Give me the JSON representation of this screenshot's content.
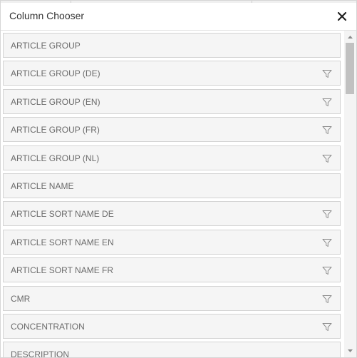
{
  "dialog": {
    "title": "Column Chooser",
    "close_icon": "close-icon"
  },
  "columns": [
    {
      "label": "ARTICLE GROUP",
      "filterable": false
    },
    {
      "label": "ARTICLE GROUP (DE)",
      "filterable": true
    },
    {
      "label": "ARTICLE GROUP (EN)",
      "filterable": true
    },
    {
      "label": "ARTICLE GROUP (FR)",
      "filterable": true
    },
    {
      "label": "ARTICLE GROUP (NL)",
      "filterable": true
    },
    {
      "label": "ARTICLE NAME",
      "filterable": false
    },
    {
      "label": "ARTICLE SORT NAME DE",
      "filterable": true
    },
    {
      "label": "ARTICLE SORT NAME EN",
      "filterable": true
    },
    {
      "label": "ARTICLE SORT NAME FR",
      "filterable": true
    },
    {
      "label": "CMR",
      "filterable": true
    },
    {
      "label": "CONCENTRATION",
      "filterable": true
    },
    {
      "label": "DESCRIPTION",
      "filterable": false
    }
  ],
  "icons": {
    "filter": "filter-icon",
    "scroll_up": "scroll-up-arrow-icon",
    "scroll_down": "scroll-down-arrow-icon"
  },
  "colors": {
    "item_background": "#f5f5f5",
    "item_border": "#d3d3d3",
    "label_text": "#6b6b6b",
    "title_text": "#333333"
  }
}
